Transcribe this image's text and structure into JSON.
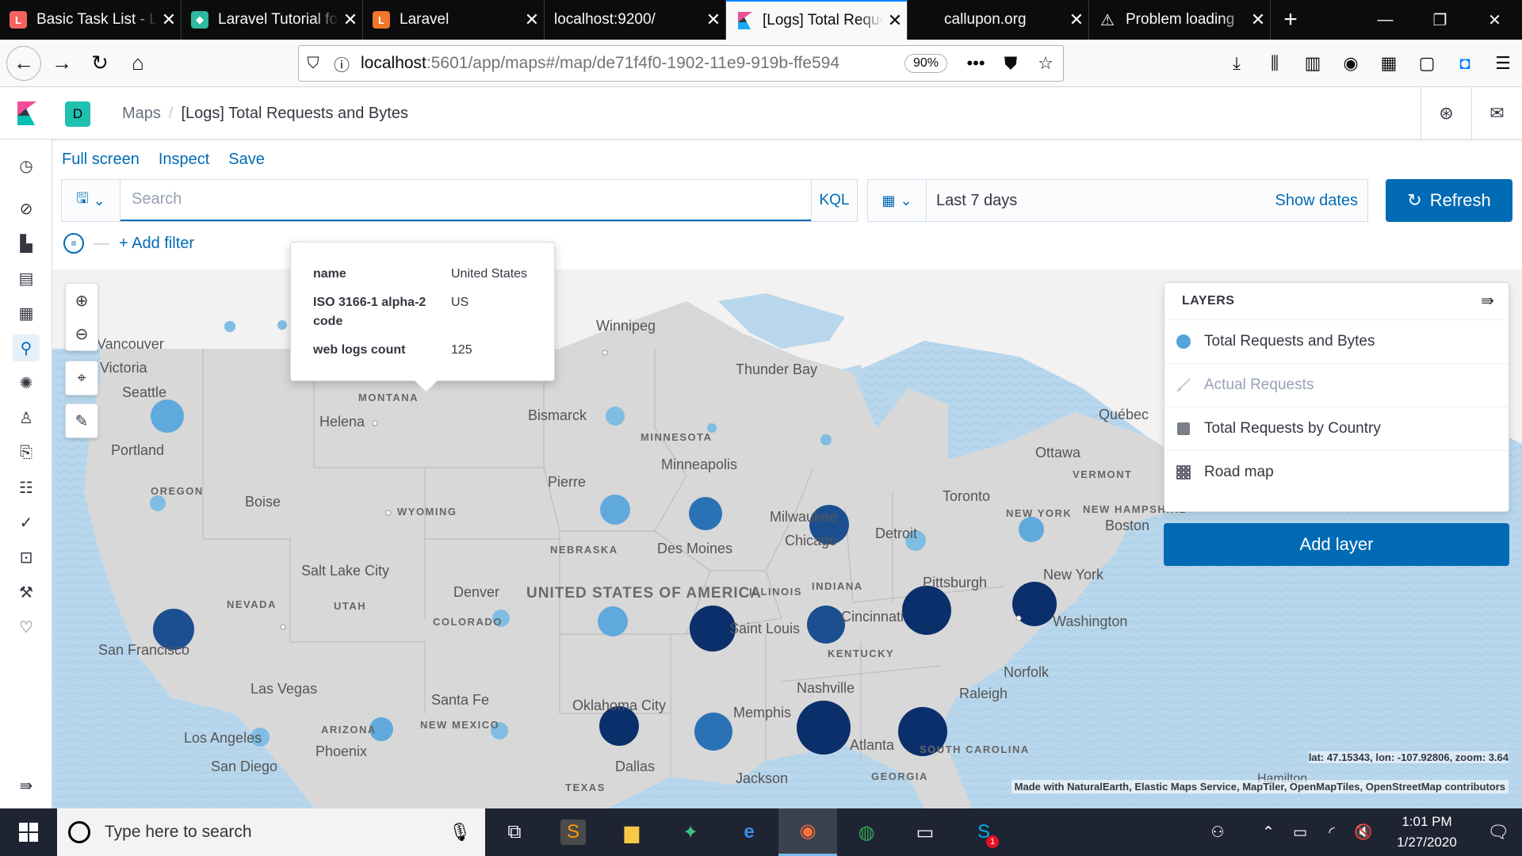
{
  "browser": {
    "tabs": [
      {
        "title": "Basic Task List - La",
        "favicon": "laravel-icon",
        "active": false
      },
      {
        "title": "Laravel Tutorial fo",
        "favicon": "laravel-tutorial-icon",
        "active": false
      },
      {
        "title": "Laravel",
        "favicon": "laravel-orange-icon",
        "active": false
      },
      {
        "title": "localhost:9200/",
        "favicon": "",
        "active": false
      },
      {
        "title": "[Logs] Total Reque",
        "favicon": "kibana-icon",
        "active": true
      },
      {
        "title": "callupon.org",
        "favicon": "",
        "active": false
      },
      {
        "title": "Problem loading",
        "favicon": "warning-icon",
        "active": false
      }
    ],
    "url_host": "localhost",
    "url_rest": ":5601/app/maps#/map/de71f4f0-1902-11e9-919b-ffe594",
    "zoom": "90%"
  },
  "kibana": {
    "space_initial": "D",
    "breadcrumb_app": "Maps",
    "breadcrumb_separator": "/",
    "breadcrumb_page": "[Logs] Total Requests and Bytes"
  },
  "top_menu": {
    "full_screen": "Full screen",
    "inspect": "Inspect",
    "save": "Save"
  },
  "query": {
    "placeholder": "Search",
    "language": "KQL"
  },
  "time": {
    "range": "Last 7 days",
    "show_dates": "Show dates",
    "refresh": "Refresh"
  },
  "filters": {
    "add_filter": "+ Add filter"
  },
  "tooltip": {
    "rows": [
      {
        "key": "name",
        "value": "United States"
      },
      {
        "key": "ISO 3166-1 alpha-2 code",
        "value": "US"
      },
      {
        "key": "web logs count",
        "value": "125"
      }
    ]
  },
  "layers_panel": {
    "title": "LAYERS",
    "layers": [
      {
        "name": "Total Requests and Bytes",
        "icon": "circle",
        "color": "#54a3d9",
        "disabled": false
      },
      {
        "name": "Actual Requests",
        "icon": "line",
        "color": "#c5ccd6",
        "disabled": true
      },
      {
        "name": "Total Requests by Country",
        "icon": "square",
        "color": "#7a7f87",
        "disabled": false
      },
      {
        "name": "Road map",
        "icon": "grid",
        "color": "#343741",
        "disabled": false
      }
    ],
    "add_layer": "Add layer"
  },
  "map": {
    "coords": "lat: 47.15343, lon: -107.92806, zoom: 3.64",
    "attribution": "Made with NaturalEarth, Elastic Maps Service, MapTiler, OpenMapTiles, OpenStreetMap contributors",
    "colors": {
      "light": "#5fa9dc",
      "mid": "#2a72b5",
      "dark": "#1c4f8f",
      "darkest": "#0b2f6b",
      "water": "#b9d7ec",
      "land": "#d7d7d7",
      "land_other": "#f2f2f2"
    },
    "labels": {
      "cities": [
        "Vancouver",
        "Victoria",
        "Seattle",
        "Portland",
        "Helena",
        "Winnipeg",
        "Thunder Bay",
        "Bismarck",
        "Minneapolis",
        "Pierre",
        "Boise",
        "Toronto",
        "Ottawa",
        "Québec",
        "Boston",
        "New York",
        "Milwaukee",
        "Chicago",
        "Detroit",
        "Des Moines",
        "Salt Lake City",
        "Denver",
        "Saint Louis",
        "Cincinnati",
        "Pittsburgh",
        "Washington",
        "San Francisco",
        "Las Vegas",
        "Santa Fe",
        "Oklahoma City",
        "Memphis",
        "Nashville",
        "Norfolk",
        "Raleigh",
        "Los Angeles",
        "San Diego",
        "Phoenix",
        "Dallas",
        "Jackson",
        "Atlanta",
        "Hamilton"
      ],
      "regions": [
        "MONTANA",
        "MINNESOTA",
        "OREGON",
        "WYOMING",
        "NEBRASKA",
        "NEVADA",
        "UTAH",
        "COLORADO",
        "ILLINOIS",
        "INDIANA",
        "KENTUCKY",
        "ARIZONA",
        "NEW MEXICO",
        "TEXAS",
        "GEORGIA",
        "NEW YORK",
        "VERMONT",
        "NEW HAMPSHIRE",
        "SOUTH CAROLINA"
      ],
      "country": "UNITED STATES OF AMERICA"
    }
  },
  "taskbar": {
    "search_placeholder": "Type here to search",
    "time": "1:01 PM",
    "date": "1/27/2020",
    "skype_badge": "1"
  }
}
